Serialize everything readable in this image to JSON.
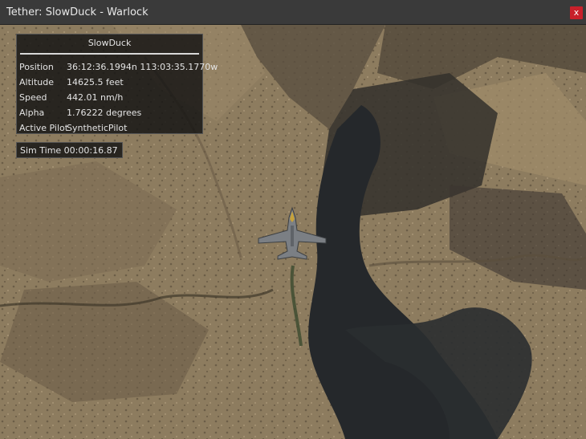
{
  "window": {
    "title": "Tether: SlowDuck - Warlock",
    "close_label": "x"
  },
  "hud": {
    "entity_name": "SlowDuck",
    "rows": [
      {
        "label": "Position",
        "value": "36:12:36.1994n 113:03:35.1770w"
      },
      {
        "label": "Altitude",
        "value": "14625.5 feet"
      },
      {
        "label": "Speed",
        "value": "442.01 nm/h"
      },
      {
        "label": "Alpha",
        "value": "1.76222 degrees"
      },
      {
        "label": "Active Pilot",
        "value": "SyntheticPilot"
      }
    ]
  },
  "sim_time": {
    "label": "Sim Time",
    "value": "00:00:16.87"
  },
  "icons": {
    "close": "close-icon",
    "aircraft": "fighter-jet-icon"
  },
  "colors": {
    "titlebar": "#3a3a3a",
    "close_button": "#c8202a",
    "terrain": "#8a7a60",
    "river": "#26282a"
  }
}
